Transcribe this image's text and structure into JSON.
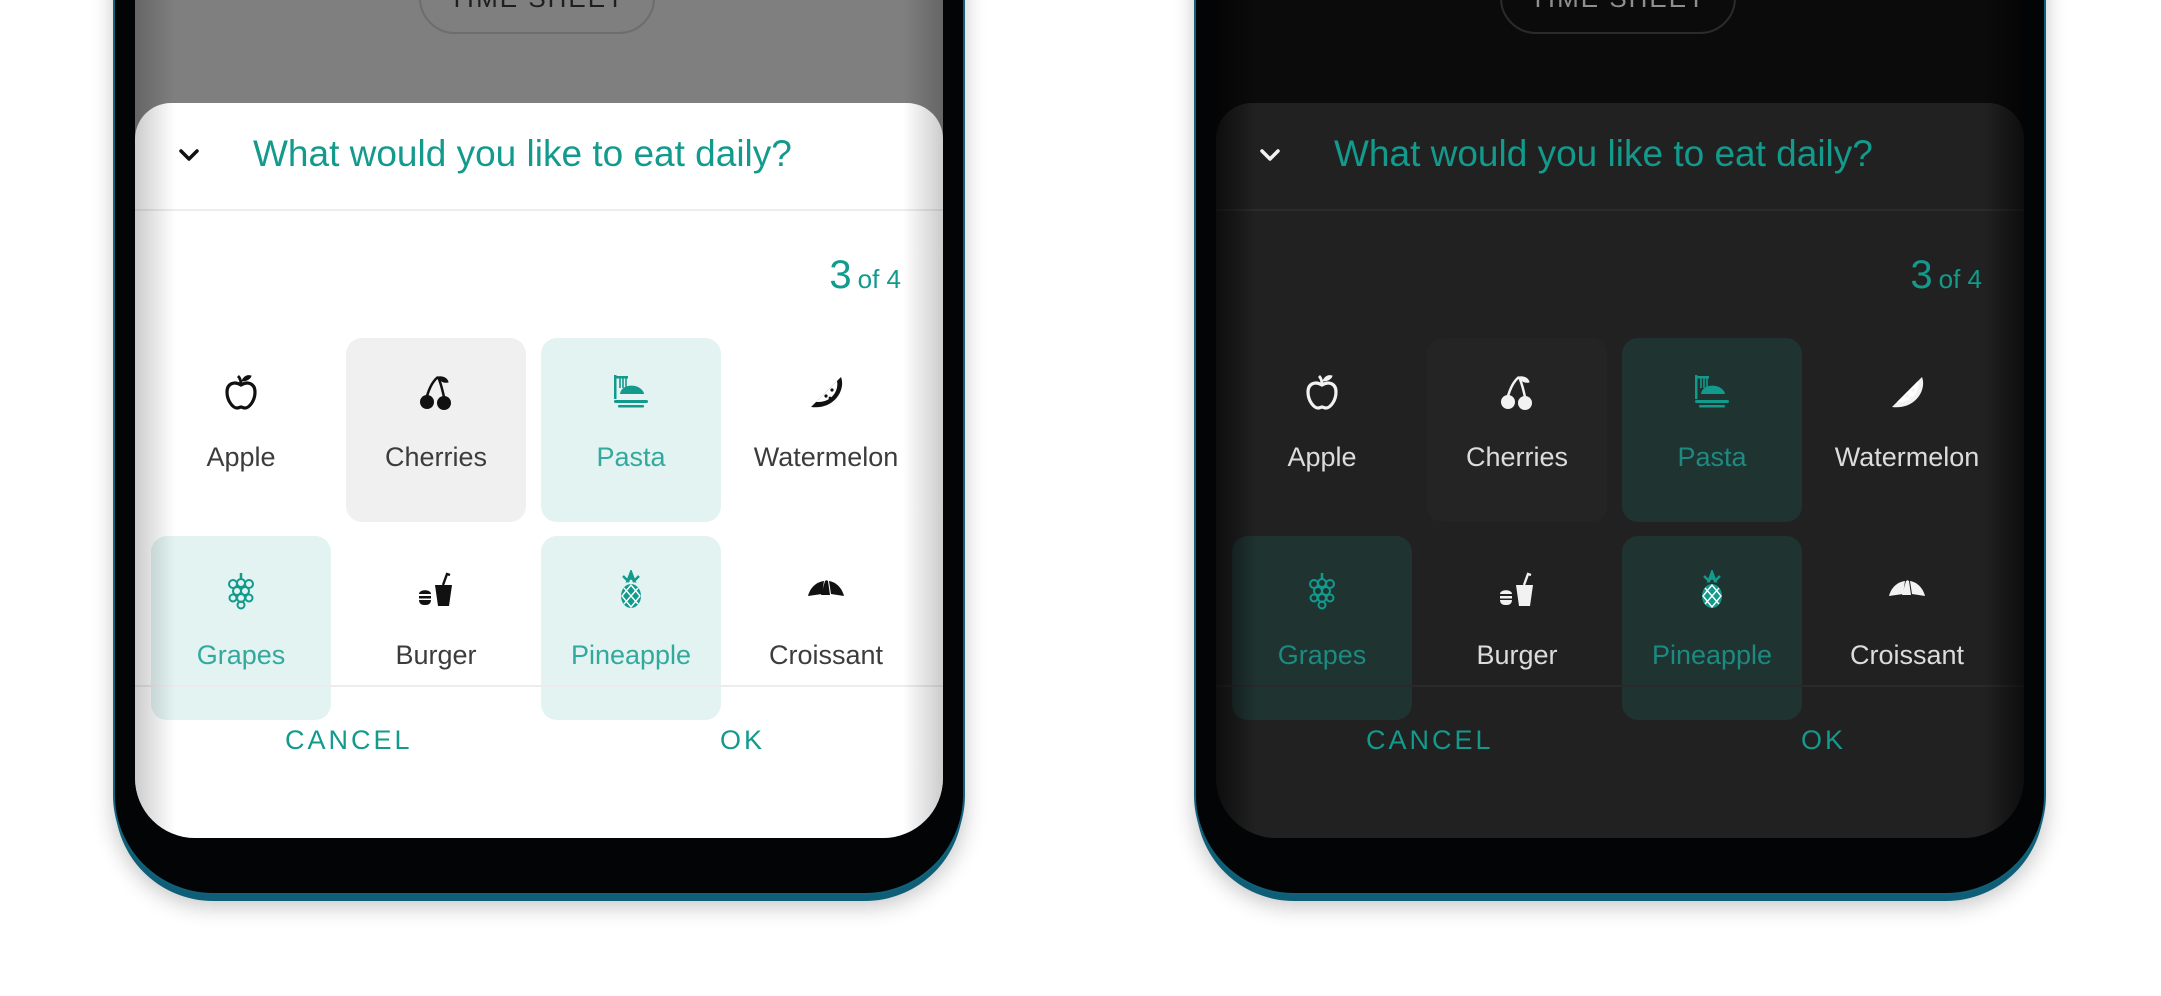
{
  "chip_label": "TIME SHEET",
  "dialog": {
    "title": "What would you like to eat daily?",
    "counter_current": "3",
    "counter_of": "of 4",
    "cancel_label": "CANCEL",
    "ok_label": "OK"
  },
  "foods": [
    {
      "label": "Apple",
      "icon": "apple-icon",
      "state": "normal"
    },
    {
      "label": "Cherries",
      "icon": "cherries-icon",
      "state": "pressed"
    },
    {
      "label": "Pasta",
      "icon": "pasta-icon",
      "state": "selected"
    },
    {
      "label": "Watermelon",
      "icon": "watermelon-icon",
      "state": "normal"
    },
    {
      "label": "Grapes",
      "icon": "grapes-icon",
      "state": "selected"
    },
    {
      "label": "Burger",
      "icon": "burger-icon",
      "state": "normal"
    },
    {
      "label": "Pineapple",
      "icon": "pineapple-icon",
      "state": "selected"
    },
    {
      "label": "Croissant",
      "icon": "croissant-icon",
      "state": "normal"
    }
  ],
  "theme": {
    "accent": "#129a8c",
    "light_selected_bg": "#e2f3f2",
    "dark_selected_bg": "#1f3331",
    "device_frame": "#12617a"
  }
}
